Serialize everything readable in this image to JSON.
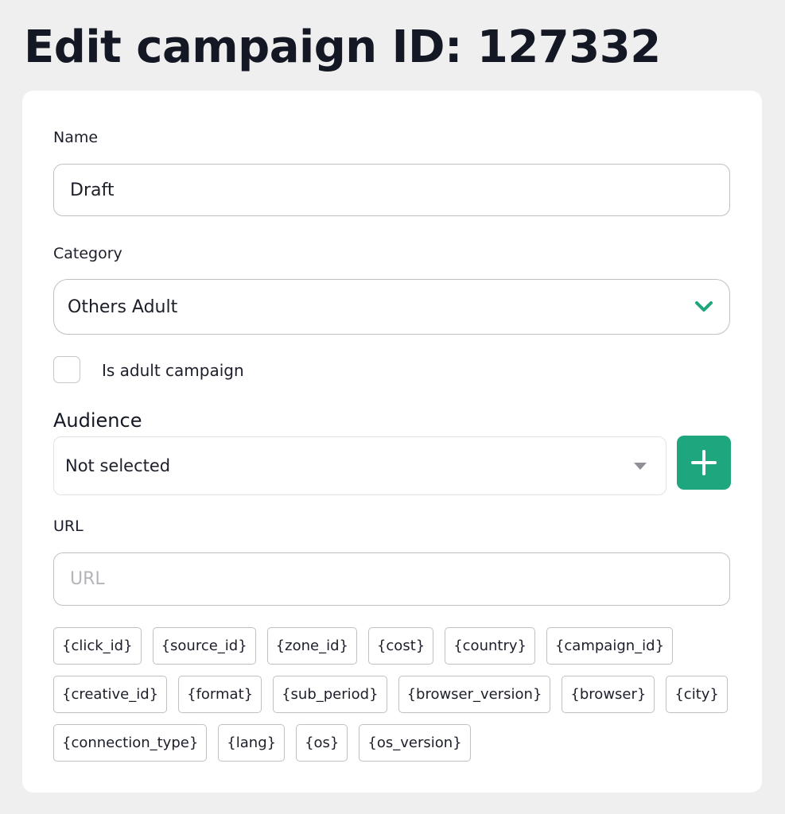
{
  "page": {
    "title": "Edit campaign ID: 127332"
  },
  "form": {
    "name": {
      "label": "Name",
      "value": "Draft"
    },
    "category": {
      "label": "Category",
      "selected": "Others Adult",
      "icon": "chevron-down-icon"
    },
    "adult": {
      "label": "Is adult campaign",
      "checked": false
    },
    "audience": {
      "label": "Audience",
      "selected": "Not selected",
      "add_icon": "plus-icon"
    },
    "url": {
      "label": "URL",
      "value": "",
      "placeholder": "URL"
    },
    "macros": [
      "{click_id}",
      "{source_id}",
      "{zone_id}",
      "{cost}",
      "{country}",
      "{campaign_id}",
      "{creative_id}",
      "{format}",
      "{sub_period}",
      "{browser_version}",
      "{browser}",
      "{city}",
      "{connection_type}",
      "{lang}",
      "{os}",
      "{os_version}"
    ]
  },
  "colors": {
    "accent": "#1ea67e",
    "background": "#efefef",
    "card": "#ffffff",
    "text": "#1c1e2a",
    "border": "#bfc0c4"
  }
}
